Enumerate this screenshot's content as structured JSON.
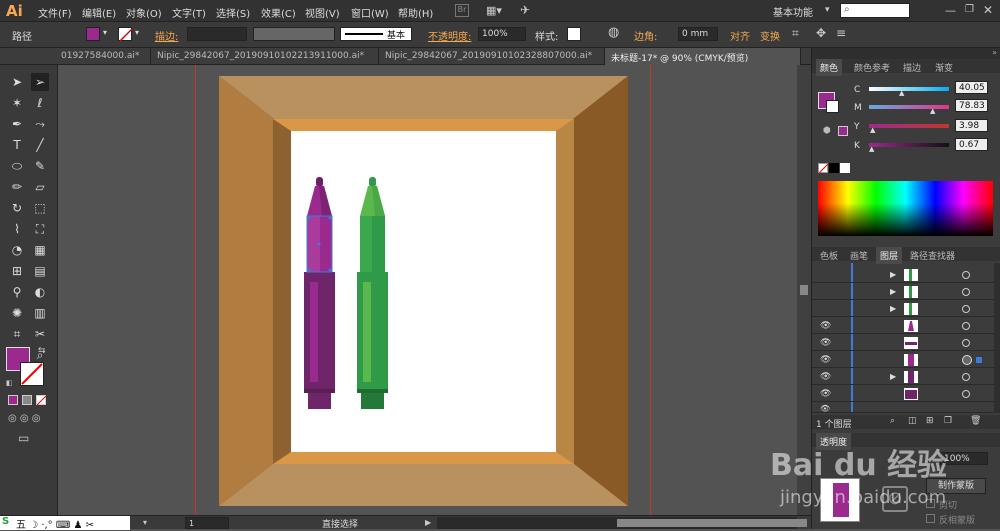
{
  "app": {
    "logo": "Ai",
    "workspace": "基本功能",
    "search_icon": "search-icon"
  },
  "menu": [
    "文件(F)",
    "编辑(E)",
    "对象(O)",
    "文字(T)",
    "选择(S)",
    "效果(C)",
    "视图(V)",
    "窗口(W)",
    "帮助(H)"
  ],
  "control": {
    "object_type": "路径",
    "stroke_label": "描边:",
    "brush_label": "基本",
    "opacity_label": "不透明度:",
    "opacity_value": "100%",
    "style_label": "样式:",
    "corner_label": "边角:",
    "corner_value": "0 mm",
    "align_label": "对齐",
    "transform_label": "变换",
    "fill_color": "#9b2a8f"
  },
  "tabs": [
    "01927584000.ai*",
    "Nipic_29842067_20190910102213911000.ai*",
    "Nipic_29842067_20190910102328807000.ai*",
    "未标题-17* @ 90% (CMYK/预览)"
  ],
  "color_panel": {
    "tabs": [
      "颜色",
      "颜色参考",
      "描边",
      "渐变"
    ],
    "c": "40.05",
    "m": "78.83",
    "y": "3.98",
    "k": "0.67"
  },
  "layers_panel": {
    "tabs": [
      "色板",
      "画笔",
      "图层",
      "路径查找器"
    ],
    "count_label": "1 个图层"
  },
  "transparency_panel": {
    "tab": "透明度",
    "opacity": "100%",
    "make_mask": "制作蒙版",
    "clip_label": "剪切",
    "invert_label": "反相蒙版"
  },
  "status": {
    "zoom": "1",
    "tool": "直接选择"
  },
  "colors": {
    "purple": "#9b2a8f",
    "green": "#2f9a47",
    "frame": "#b5844a"
  },
  "watermark": {
    "brand": "Bai du 经验",
    "url": "jingyan.baidu.com"
  }
}
